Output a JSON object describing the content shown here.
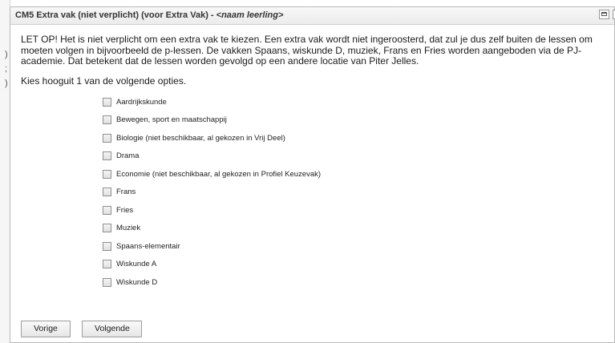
{
  "background": {
    "fragments": [
      ")",
      ";",
      ")"
    ]
  },
  "dialog": {
    "title_prefix": "CM5 Extra vak (niet verplicht) (voor Extra Vak) - ",
    "title_name": "<naam leerling>",
    "close_glyph": "×"
  },
  "notice": "LET OP! Het is niet verplicht om een extra vak te kiezen. Een extra vak wordt niet ingeroosterd, dat zul je dus zelf buiten de lessen om moeten volgen in bijvoorbeeld de p-lessen. De vakken Spaans, wiskunde D, muziek, Frans en Fries worden aangeboden via de PJ-academie. Dat betekent dat de lessen worden gevolgd op een andere locatie van Piter Jelles.",
  "instruction": "Kies hooguit 1 van de volgende opties.",
  "options": [
    {
      "label": "Aardrijkskunde",
      "checked": false
    },
    {
      "label": "Bewegen, sport en maatschappij",
      "checked": false
    },
    {
      "label": "Biologie (niet beschikbaar, al gekozen in Vrij Deel)",
      "checked": false
    },
    {
      "label": "Drama",
      "checked": false
    },
    {
      "label": "Economie (niet beschikbaar, al gekozen in Profiel Keuzevak)",
      "checked": false
    },
    {
      "label": "Frans",
      "checked": false
    },
    {
      "label": "Fries",
      "checked": false
    },
    {
      "label": "Muziek",
      "checked": false
    },
    {
      "label": "Spaans-elementair",
      "checked": false
    },
    {
      "label": "Wiskunde A",
      "checked": false
    },
    {
      "label": "Wiskunde D",
      "checked": false
    }
  ],
  "buttons": {
    "previous": "Vorige",
    "next": "Volgende"
  }
}
